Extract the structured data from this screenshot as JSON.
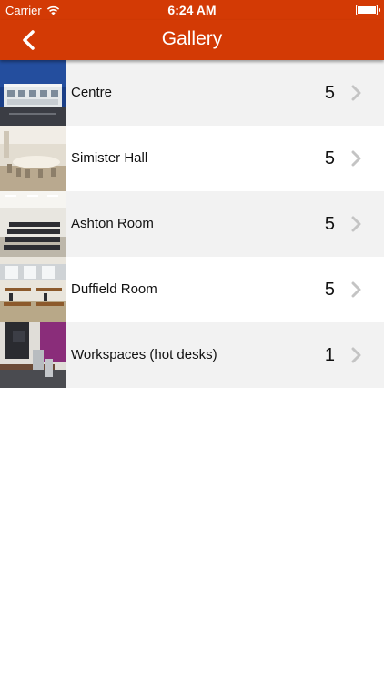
{
  "status": {
    "carrier": "Carrier",
    "time": "6:24 AM"
  },
  "nav": {
    "title": "Gallery"
  },
  "items": [
    {
      "label": "Centre",
      "count": "5"
    },
    {
      "label": "Simister Hall",
      "count": "5"
    },
    {
      "label": "Ashton Room",
      "count": "5"
    },
    {
      "label": "Duffield Room",
      "count": "5"
    },
    {
      "label": "Workspaces (hot desks)",
      "count": "1"
    }
  ],
  "colors": {
    "accent": "#d33a05",
    "row_alt": "#f2f2f2"
  }
}
